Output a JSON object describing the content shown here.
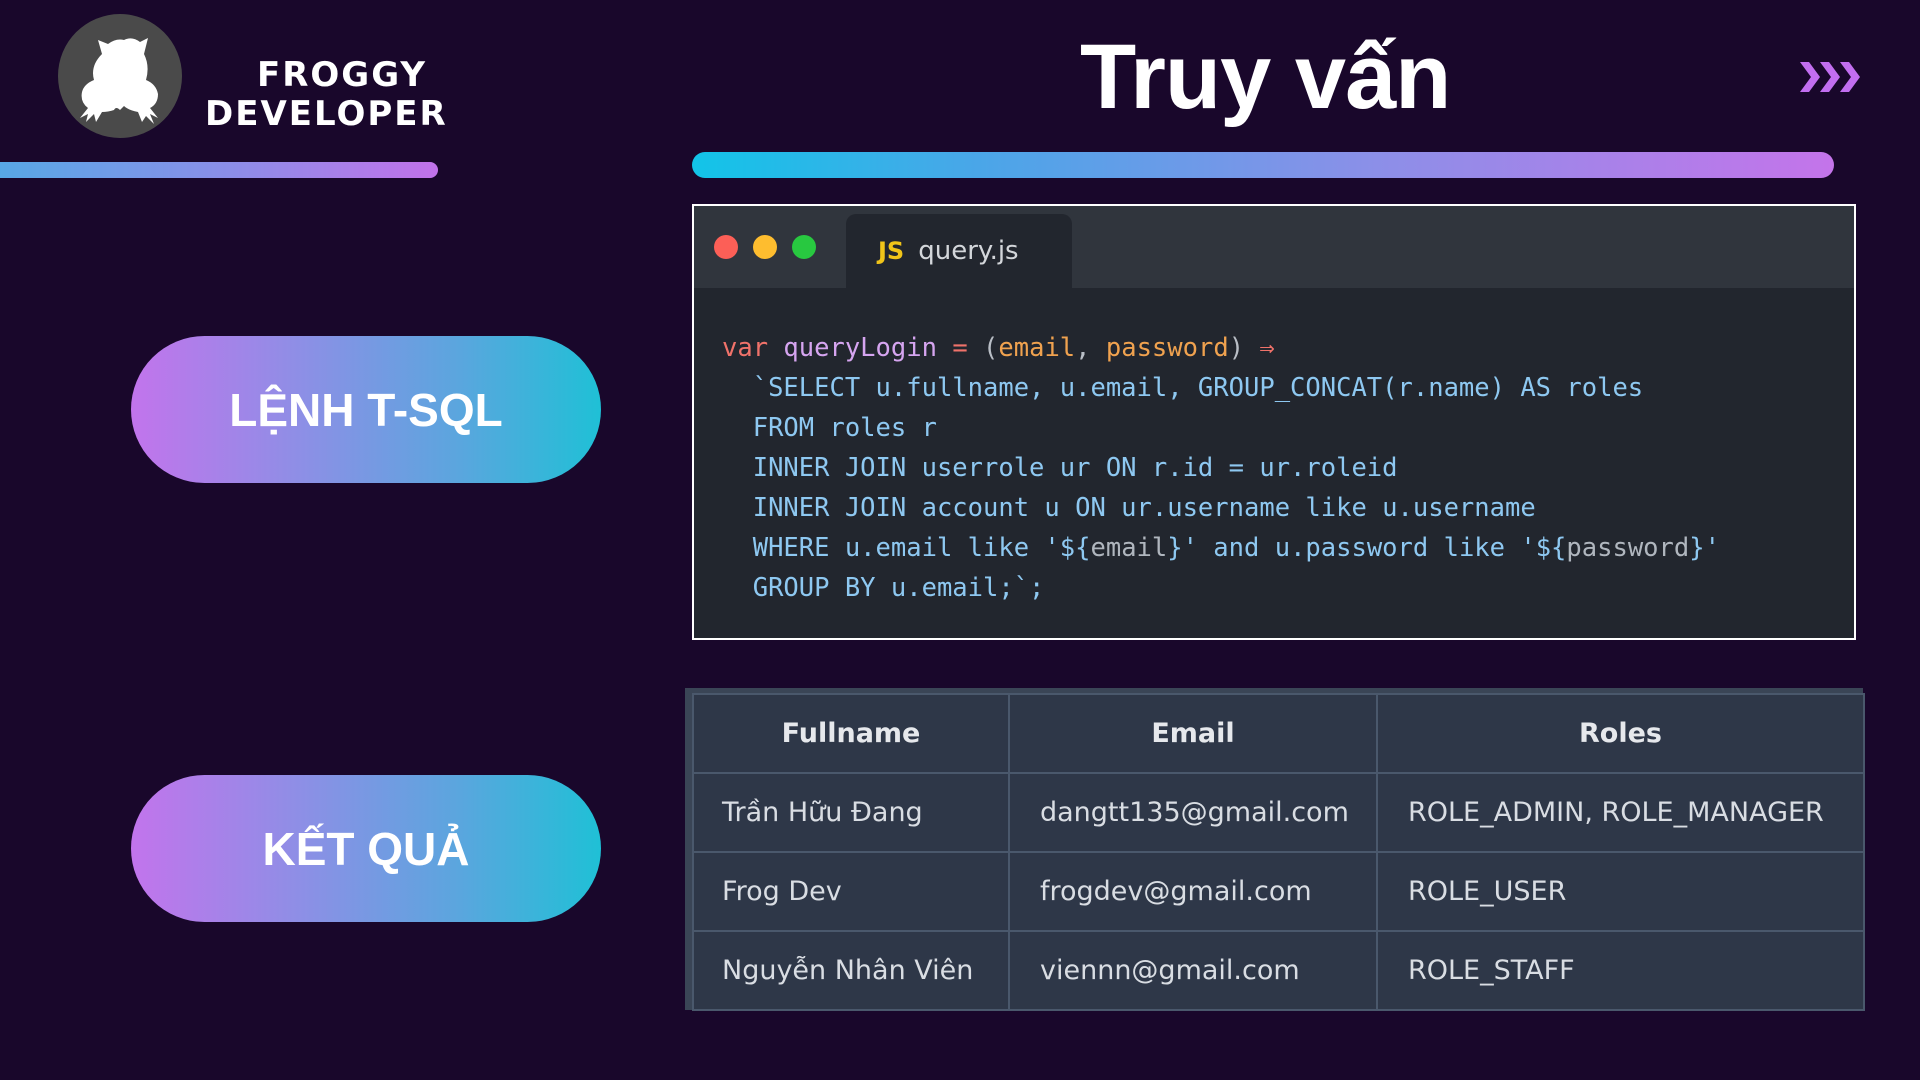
{
  "brand": {
    "line1": "FROGGY",
    "line2": "DEVELOPER",
    "logo_icon": "frog-silhouette-icon"
  },
  "header": {
    "title": "Truy vấn",
    "next_icon": "triple-chevron-right-icon"
  },
  "colors": {
    "background": "#19072b",
    "gradient_purple": "#c272ea",
    "gradient_cyan": "#12c4e8",
    "code_bg": "#22262e",
    "table_bg": "#2e3748"
  },
  "sections": {
    "sql_label": "LỆNH T-SQL",
    "result_label": "KẾT QUẢ"
  },
  "code_window": {
    "tab_icon": "JS",
    "tab_filename": "query.js",
    "line1": {
      "kw": "var",
      "name": "queryLogin",
      "eq": "=",
      "open": "(",
      "arg1": "email",
      "comma": ",",
      "arg2": "password",
      "close": ")",
      "arrow": "⇒"
    },
    "line2": "`SELECT u.fullname, u.email, GROUP_CONCAT(r.name) AS roles",
    "line3": "FROM roles r",
    "line4": "INNER JOIN userrole ur ON r.id = ur.roleid",
    "line5": "INNER JOIN account u ON ur.username like u.username",
    "line6": {
      "a": "WHERE u.email like '${",
      "v1": "email",
      "b": "}' and u.password like '${",
      "v2": "password",
      "c": "}'"
    },
    "line7": "GROUP BY u.email;`;"
  },
  "result_table": {
    "headers": [
      "Fullname",
      "Email",
      "Roles"
    ],
    "rows": [
      [
        "Trần Hữu Đang",
        "dangtt135@gmail.com",
        "ROLE_ADMIN, ROLE_MANAGER"
      ],
      [
        "Frog Dev",
        "frogdev@gmail.com",
        "ROLE_USER"
      ],
      [
        "Nguyễn Nhân Viên",
        "viennn@gmail.com",
        "ROLE_STAFF"
      ]
    ]
  }
}
